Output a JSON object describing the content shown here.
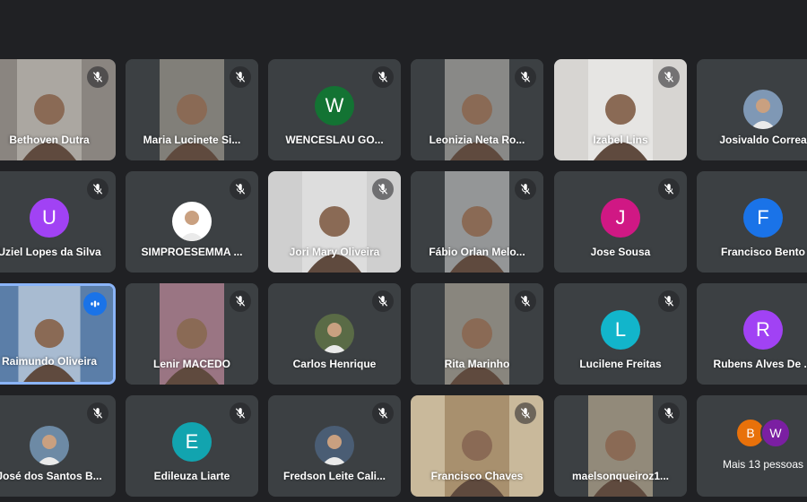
{
  "participants": [
    {
      "name": "Bethoven Dutra",
      "muted": true,
      "kind": "video",
      "bg": "#8a8580",
      "fg": "#c6c2bc"
    },
    {
      "name": "Maria Lucinete Si...",
      "muted": true,
      "kind": "video",
      "bg": "#3c4043",
      "fg": "#b9b3a6"
    },
    {
      "name": "WENCESLAU GO...",
      "muted": true,
      "kind": "letter",
      "letter": "W",
      "color": "#137333"
    },
    {
      "name": "Leonizia Neta Ro...",
      "muted": true,
      "kind": "video",
      "bg": "#3c4043",
      "fg": "#c9c5bf"
    },
    {
      "name": "Izabel Lins",
      "muted": true,
      "kind": "video",
      "bg": "#d7d5d2",
      "fg": "#f2f2f0"
    },
    {
      "name": "Josivaldo Correa",
      "muted": false,
      "kind": "photo",
      "bg": "#7f98b5"
    },
    {
      "name": "Uziel Lopes da Silva",
      "muted": true,
      "kind": "letter",
      "letter": "U",
      "color": "#a142f4"
    },
    {
      "name": "SIMPROESEMMA ...",
      "muted": true,
      "kind": "photo",
      "bg": "#ffffff"
    },
    {
      "name": "Jori Mary Oliveira",
      "muted": true,
      "kind": "video",
      "bg": "#cfcfcf",
      "fg": "#e9e9e9"
    },
    {
      "name": "Fábio Orlan Melo...",
      "muted": true,
      "kind": "video",
      "bg": "#3c4043",
      "fg": "#dcdcdc"
    },
    {
      "name": "Jose Sousa",
      "muted": true,
      "kind": "letter",
      "letter": "J",
      "color": "#d01884"
    },
    {
      "name": "Francisco Bento",
      "muted": false,
      "kind": "letter",
      "letter": "F",
      "color": "#1a73e8"
    },
    {
      "name": "Raimundo Oliveira",
      "muted": false,
      "kind": "video",
      "bg": "#5b7ea8",
      "fg": "#e8edf2",
      "speaking": true
    },
    {
      "name": "Lenir MACEDO",
      "muted": true,
      "kind": "video",
      "bg": "#3c4043",
      "fg": "#e8a0b8"
    },
    {
      "name": "Carlos Henrique",
      "muted": true,
      "kind": "photo",
      "bg": "#5a6b46"
    },
    {
      "name": "Rita Marinho",
      "muted": true,
      "kind": "video",
      "bg": "#3c4043",
      "fg": "#c8bfae"
    },
    {
      "name": "Lucilene Freitas",
      "muted": true,
      "kind": "letter",
      "letter": "L",
      "color": "#12b5cb"
    },
    {
      "name": "Rubens Alves De ...",
      "muted": false,
      "kind": "letter",
      "letter": "R",
      "color": "#a142f4"
    },
    {
      "name": "José dos Santos B...",
      "muted": true,
      "kind": "photo",
      "bg": "#6d8aa5"
    },
    {
      "name": "Edileuza Liarte",
      "muted": true,
      "kind": "letter",
      "letter": "E",
      "color": "#12a4af"
    },
    {
      "name": "Fredson Leite Cali...",
      "muted": true,
      "kind": "photo",
      "bg": "#4a5d74"
    },
    {
      "name": "Francisco Chaves",
      "muted": true,
      "kind": "video",
      "bg": "#c9b99b",
      "fg": "#8c6f49"
    },
    {
      "name": "maelsonqueiroz1...",
      "muted": true,
      "kind": "video",
      "bg": "#3c4043",
      "fg": "#d8c7a8"
    }
  ],
  "more": {
    "label": "Mais 13 pessoas",
    "avatars": [
      {
        "letter": "B",
        "color": "#e8710a"
      },
      {
        "letter": "W",
        "color": "#7b1fa2"
      }
    ]
  }
}
